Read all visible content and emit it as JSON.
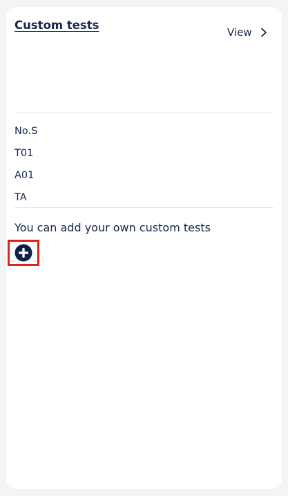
{
  "card": {
    "title": "Custom tests",
    "view_label": "View"
  },
  "tests": [
    {
      "label": "No.S"
    },
    {
      "label": "T01"
    },
    {
      "label": "A01"
    },
    {
      "label": "TA"
    }
  ],
  "add_section": {
    "text": "You can add your own custom tests",
    "icon": "plus-circle-icon",
    "icon_color": "#0f1f45",
    "highlight_color": "#e0201c"
  }
}
